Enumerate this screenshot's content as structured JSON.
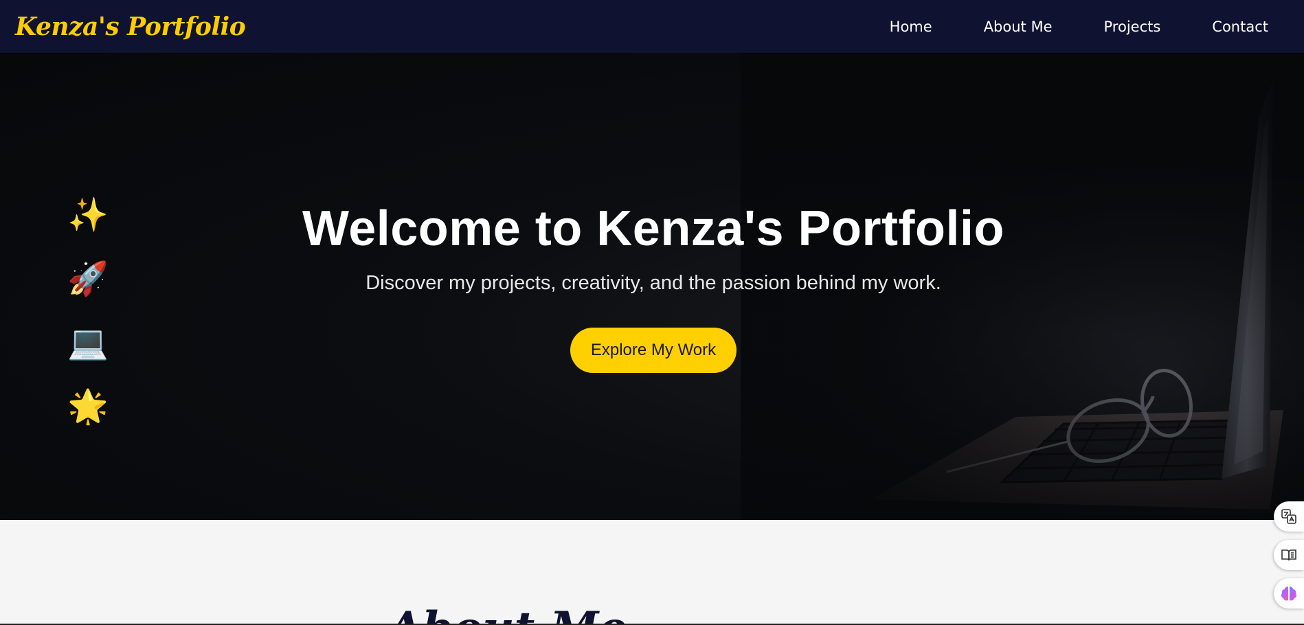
{
  "navbar": {
    "brand": "Kenza's Portfolio",
    "links": [
      "Home",
      "About Me",
      "Projects",
      "Contact"
    ]
  },
  "hero": {
    "side_icons": [
      "✨",
      "🚀",
      "💻",
      "🌟"
    ],
    "title": "Welcome to Kenza's Portfolio",
    "subtitle": "Discover my projects, creativity, and the passion behind my work.",
    "button_label": "Explore My Work"
  },
  "about": {
    "heading": "About Me"
  },
  "floating_tools": {
    "translate_icon": "translate-icon",
    "reader_icon": "book-icon",
    "ai_icon": "brain-icon"
  },
  "colors": {
    "navbar_bg": "#0f1230",
    "brand": "#ffcc00",
    "accent_button": "#ffd000",
    "hero_bg": "#06080a"
  }
}
